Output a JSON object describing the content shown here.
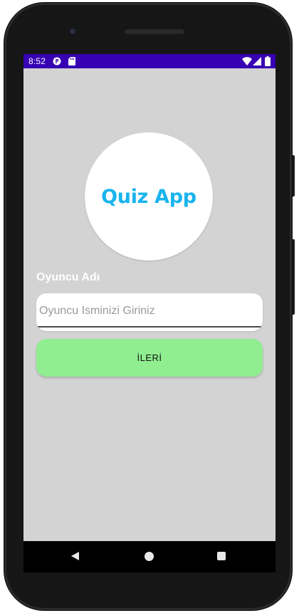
{
  "status_bar": {
    "time": "8:52",
    "background": "#3700b3",
    "icons": [
      "p-notification-icon",
      "sd-card-icon",
      "wifi-icon",
      "signal-icon",
      "battery-icon"
    ]
  },
  "app": {
    "logo_text": "Quiz App",
    "logo_color": "#18b4ee",
    "screen_background": "#d3d3d3",
    "player_label": "Oyuncu Adı",
    "name_input": {
      "value": "",
      "placeholder": "Oyuncu İsminizi Giriniz"
    },
    "next_button_label": "İLERİ",
    "next_button_color": "#90ee90"
  },
  "nav_bar": {
    "buttons": [
      "back-icon",
      "home-icon",
      "recents-icon"
    ]
  }
}
